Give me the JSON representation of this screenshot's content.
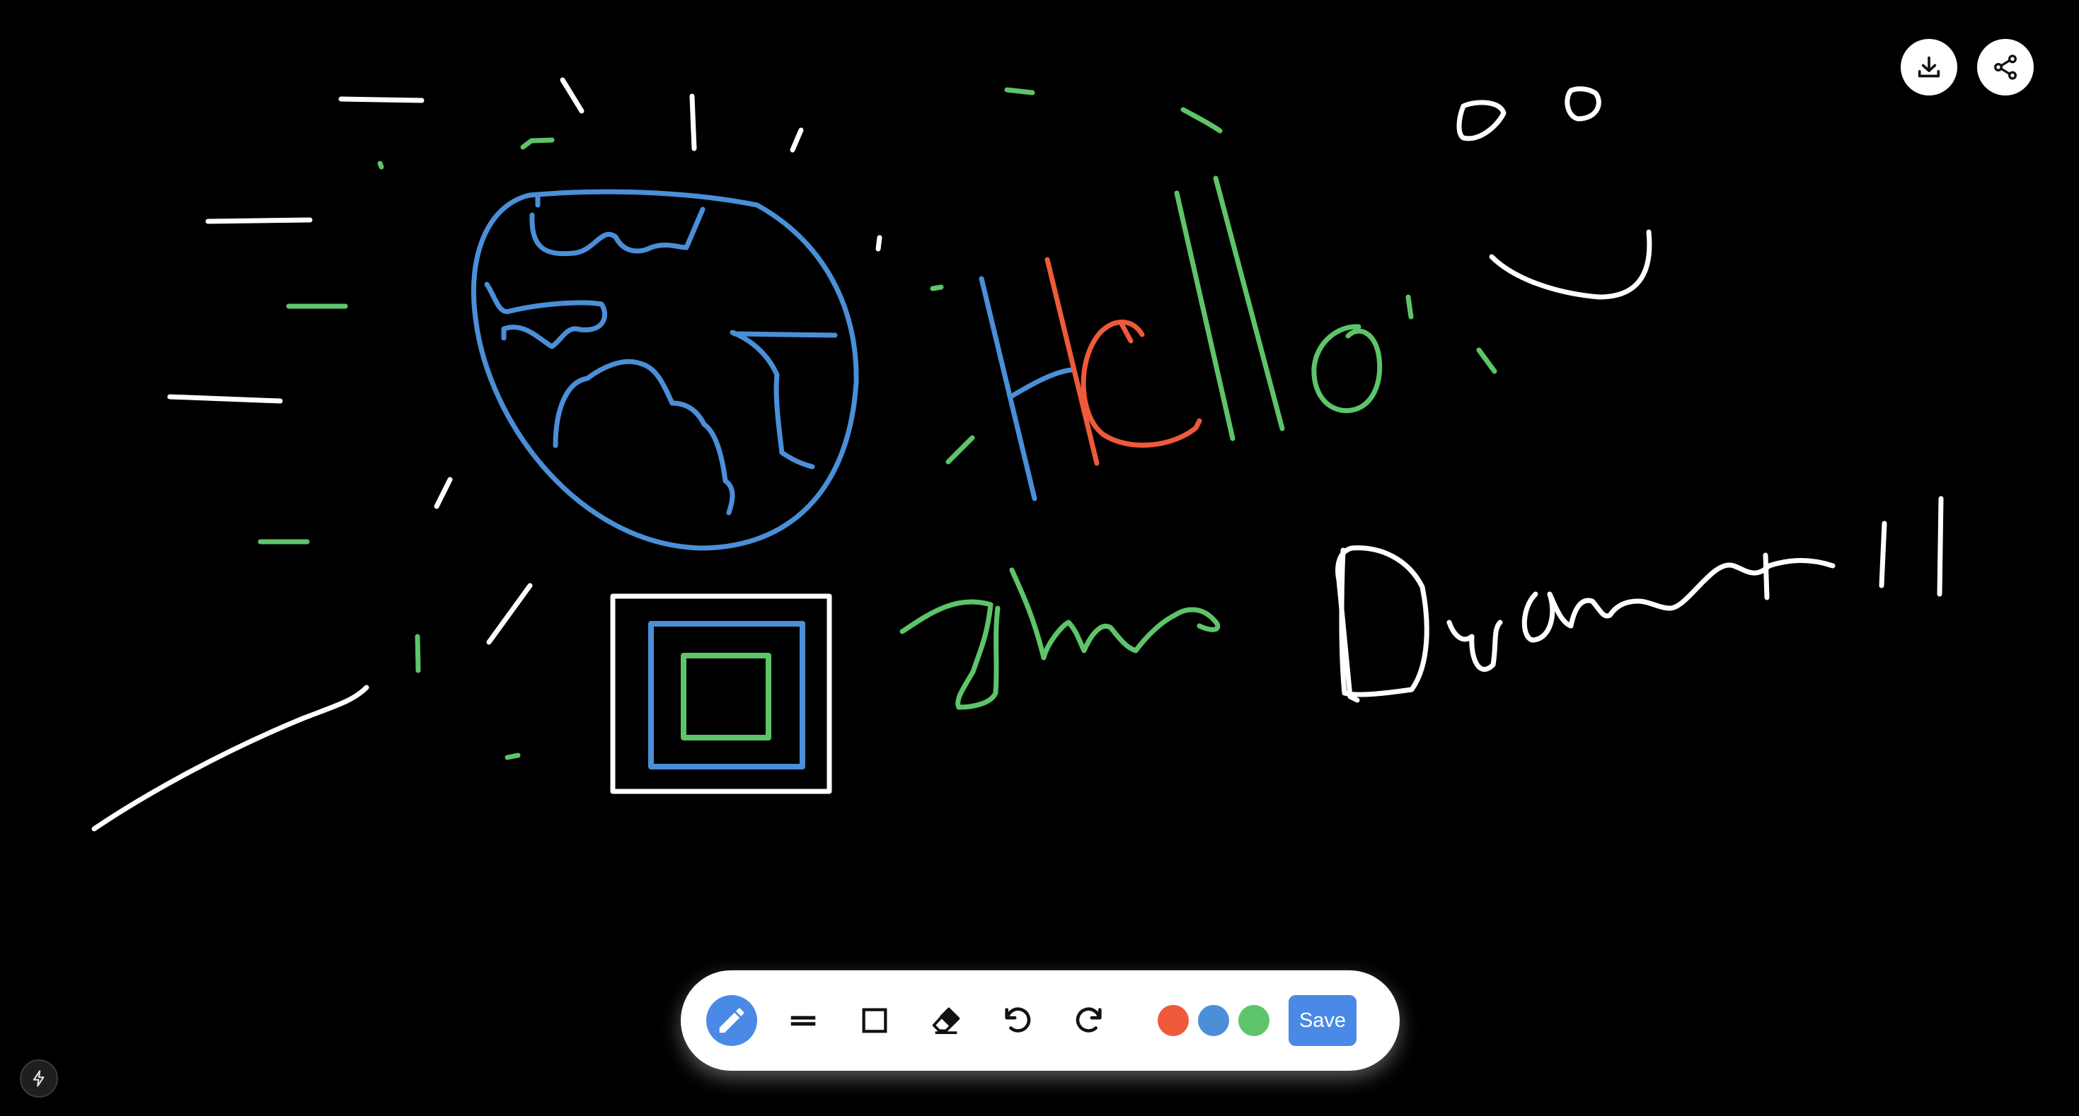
{
  "canvas": {
    "background": "#000000",
    "stroke_colors": {
      "white": "#ffffff",
      "green": "#5ec46a",
      "blue": "#4a8fd8",
      "red": "#ee5a3a"
    }
  },
  "top_actions": {
    "download_icon": "download-icon",
    "share_icon": "share-icon"
  },
  "toolbar": {
    "tools": [
      {
        "name": "pen",
        "icon": "pencil-icon",
        "active": true
      },
      {
        "name": "line",
        "icon": "double-line-icon",
        "active": false
      },
      {
        "name": "rectangle",
        "icon": "square-icon",
        "active": false
      },
      {
        "name": "eraser",
        "icon": "eraser-icon",
        "active": false
      },
      {
        "name": "undo",
        "icon": "undo-icon",
        "active": false
      },
      {
        "name": "redo",
        "icon": "redo-icon",
        "active": false
      }
    ],
    "colors": [
      "#ee5a3a",
      "#4a8fd8",
      "#5ec46a"
    ],
    "save_label": "Save",
    "accent": "#4a8ae6"
  },
  "badge": {
    "icon": "lightning-icon"
  }
}
